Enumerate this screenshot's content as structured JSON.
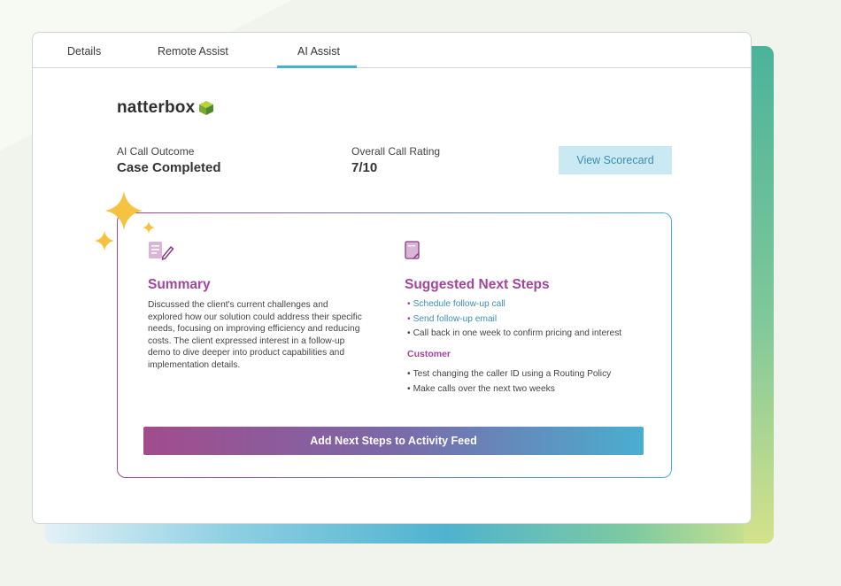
{
  "tabs": [
    {
      "label": "Details"
    },
    {
      "label": "Remote Assist"
    },
    {
      "label": "AI Assist",
      "active": true
    }
  ],
  "logo": {
    "text": "natterbox"
  },
  "outcome": {
    "label": "AI Call Outcome",
    "value": "Case Completed"
  },
  "rating": {
    "label": "Overall Call Rating",
    "value": "7/10"
  },
  "scorecard_button": {
    "label": "View Scorecard"
  },
  "summary": {
    "icon": "notepad-pen-icon",
    "title": "Summary",
    "text": "Discussed the client's current challenges and explored how our solution could address their specific needs, focusing on improving efficiency and reducing costs. The client expressed interest in a follow-up demo to dive deeper into product capabilities and implementation details."
  },
  "next_steps": {
    "icon": "document-icon",
    "title": "Suggested Next Steps",
    "items": [
      "Schedule follow-up call",
      "Send follow-up email",
      "Call back in one week to confirm pricing and interest"
    ],
    "customer_label": "Customer",
    "customer_items": [
      "Test changing the caller ID using a Routing Policy",
      "Make calls over the next two weeks"
    ]
  },
  "add_button": {
    "label": "Add Next Steps to Activity Feed"
  },
  "colors": {
    "accent_purple": "#a3459a",
    "accent_blue": "#4aaecf",
    "sparkle": "#f5c242"
  }
}
